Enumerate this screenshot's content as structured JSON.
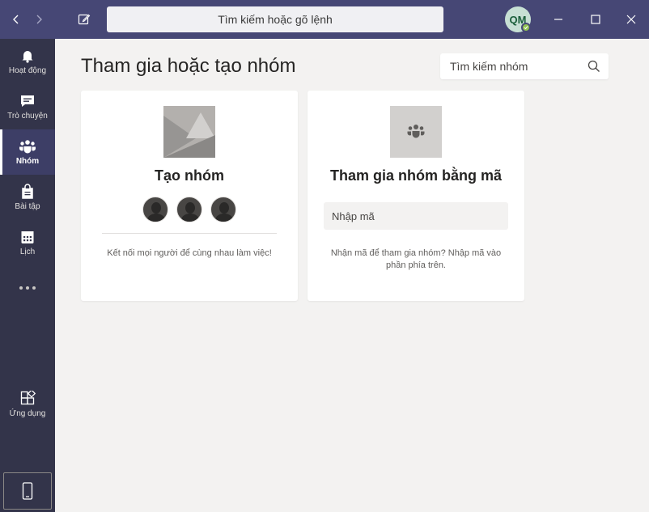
{
  "header": {
    "search_placeholder": "Tìm kiếm hoặc gõ lệnh",
    "user_initials": "QM"
  },
  "rail": {
    "items": [
      {
        "label": "Hoạt động",
        "icon": "bell-icon"
      },
      {
        "label": "Trò chuyện",
        "icon": "chat-icon"
      },
      {
        "label": "Nhóm",
        "icon": "teams-icon"
      },
      {
        "label": "Bài tập",
        "icon": "assignments-icon"
      },
      {
        "label": "Lịch",
        "icon": "calendar-icon"
      }
    ],
    "apps_label": "Ứng dụng",
    "active": "Nhóm"
  },
  "main": {
    "title": "Tham gia hoặc tạo nhóm",
    "team_search_placeholder": "Tìm kiếm nhóm",
    "create_card": {
      "title": "Tạo nhóm",
      "description": "Kết nối mọi người để cùng nhau làm việc!"
    },
    "join_card": {
      "title": "Tham gia nhóm bằng mã",
      "code_placeholder": "Nhập mã",
      "description": "Nhận mã để tham gia nhóm? Nhập mã vào phần phía trên."
    }
  },
  "colors": {
    "titlebar": "#464775",
    "rail": "#33344a",
    "background": "#f3f2f1",
    "card": "#ffffff"
  }
}
